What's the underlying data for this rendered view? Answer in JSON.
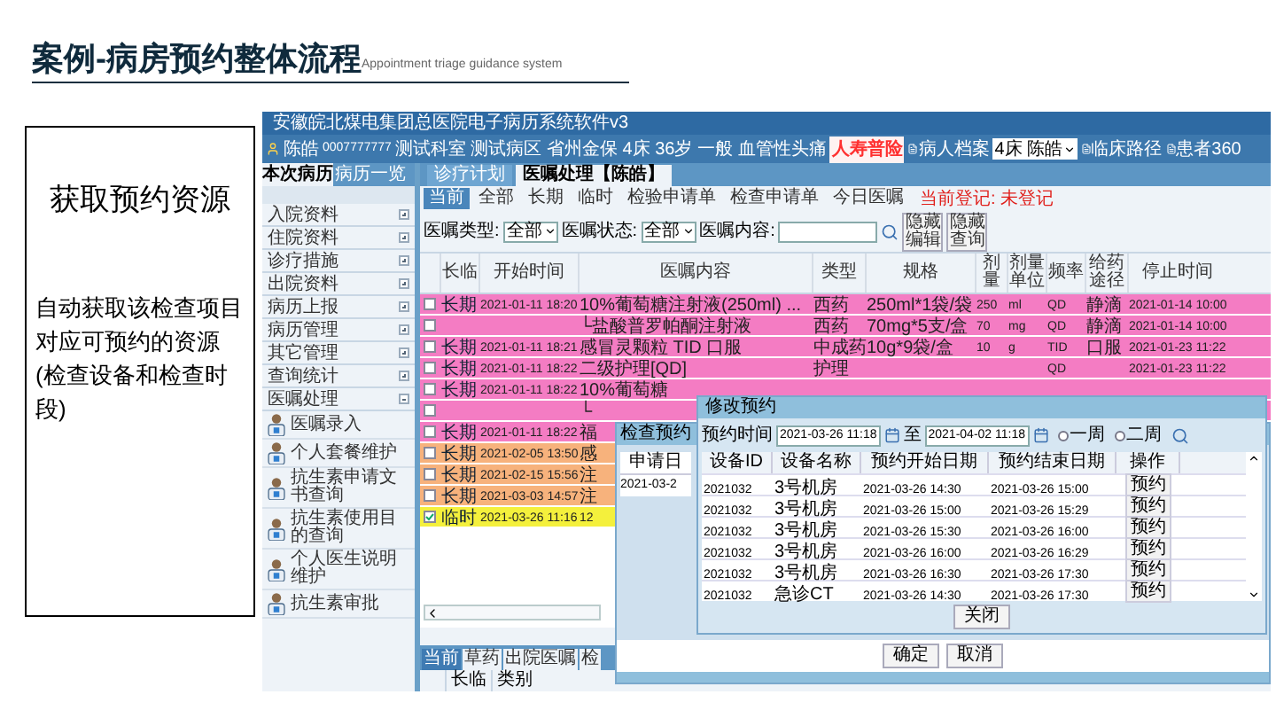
{
  "slide": {
    "title": "案例-病房预约整体流程",
    "subtitle": "Appointment triage guidance system"
  },
  "note": {
    "heading": "获取预约资源",
    "body": "自动获取该检查项目对应可预约的资源(检查设备和检查时段)"
  },
  "app": {
    "title": "安徽皖北煤电集团总医院电子病历系统软件v3",
    "patient": {
      "name": "陈皓",
      "id": "0007777777",
      "info": "测试科室 测试病区 省州金保 4床 36岁 一般 血管性头痛",
      "insurance": "人寿普险"
    },
    "toolbar": [
      {
        "kind": "link",
        "label": "病人档案"
      },
      {
        "kind": "select",
        "value": "4床 陈皓"
      },
      {
        "kind": "link",
        "label": "临床路径"
      },
      {
        "kind": "link",
        "label": "患者360"
      }
    ],
    "sidebar": {
      "tabs": [
        {
          "label": "本次病历",
          "selected": true
        },
        {
          "label": "病历一览",
          "selected": false
        }
      ],
      "items": [
        {
          "label": "入院资料",
          "expanded": false
        },
        {
          "label": "住院资料",
          "expanded": false
        },
        {
          "label": "诊疗措施",
          "expanded": false
        },
        {
          "label": "出院资料",
          "expanded": false
        },
        {
          "label": "病历上报",
          "expanded": false
        },
        {
          "label": "病历管理",
          "expanded": false
        },
        {
          "label": "其它管理",
          "expanded": false
        },
        {
          "label": "查询统计",
          "expanded": false
        },
        {
          "label": "医嘱处理",
          "expanded": true,
          "children": [
            {
              "label": "医嘱录入"
            },
            {
              "label": "个人套餐维护"
            },
            {
              "label": "抗生素申请文书查询"
            },
            {
              "label": "抗生素使用目的查询"
            },
            {
              "label": "个人医生说明维护"
            },
            {
              "label": "抗生素审批"
            }
          ]
        }
      ]
    },
    "main": {
      "tabs": [
        {
          "label": "诊疗计划",
          "selected": false
        },
        {
          "label": "医嘱处理【陈皓】",
          "selected": true
        }
      ],
      "filter_tabs": [
        {
          "label": "当前",
          "selected": true
        },
        {
          "label": "全部",
          "selected": false
        },
        {
          "label": "长期",
          "selected": false
        },
        {
          "label": "临时",
          "selected": false
        },
        {
          "label": "检验申请单",
          "selected": false
        },
        {
          "label": "检查申请单",
          "selected": false
        },
        {
          "label": "今日医嘱",
          "selected": false
        }
      ],
      "registration": "当前登记: 未登记",
      "filters": [
        {
          "label": "医嘱类型:",
          "value": "全部"
        },
        {
          "label": "医嘱状态:",
          "value": "全部"
        }
      ],
      "content_filter": {
        "label": "医嘱内容:"
      },
      "buttons": [
        "隐藏编辑",
        "隐藏查询"
      ],
      "table": {
        "columns": [
          "长临",
          "开始时间",
          "医嘱内容",
          "类型",
          "规格",
          "剂量",
          "剂量单位",
          "频率",
          "给药途径",
          "停止时间"
        ],
        "rows": [
          {
            "checked": false,
            "color": "#f47cc3",
            "cells": [
              "长期",
              "2021-01-11 18:20",
              "10%葡萄糖注射液(250ml) ...",
              "西药",
              "250ml*1袋/袋",
              "250",
              "ml",
              "QD",
              "静滴",
              "2021-01-14 10:00"
            ]
          },
          {
            "checked": false,
            "color": "#f47cc3",
            "cells": [
              "",
              "",
              "└盐酸普罗帕酮注射液",
              "西药",
              "70mg*5支/盒",
              "70",
              "mg",
              "QD",
              "静滴",
              "2021-01-14 10:00"
            ]
          },
          {
            "checked": false,
            "color": "#f47cc3",
            "cells": [
              "长期",
              "2021-01-11 18:21",
              "感冒灵颗粒 TID 口服",
              "中成药",
              "10g*9袋/盒",
              "10",
              "g",
              "TID",
              "口服",
              "2021-01-23 11:22"
            ]
          },
          {
            "checked": false,
            "color": "#f47cc3",
            "cells": [
              "长期",
              "2021-01-11 18:22",
              "二级护理[QD]",
              "护理",
              "",
              "",
              "",
              "QD",
              "",
              "2021-01-23 11:22"
            ]
          },
          {
            "checked": false,
            "color": "#f47cc3",
            "cells": [
              "长期",
              "2021-01-11 18:22",
              "10%葡萄糖"
            ]
          },
          {
            "checked": false,
            "color": "#f47cc3",
            "cells": [
              "",
              "",
              "└"
            ]
          },
          {
            "checked": false,
            "color": "#f47cc3",
            "cells": [
              "长期",
              "2021-01-11 18:22",
              "福"
            ]
          },
          {
            "checked": false,
            "color": "#f7b27c",
            "cells": [
              "长期",
              "2021-02-05 13:50",
              "感"
            ]
          },
          {
            "checked": false,
            "color": "#f7b27c",
            "cells": [
              "长期",
              "2021-02-15 15:56",
              "注"
            ]
          },
          {
            "checked": false,
            "color": "#f7b27c",
            "cells": [
              "长期",
              "2021-03-03 14:57",
              "注"
            ]
          },
          {
            "checked": true,
            "color": "#f4f03c",
            "cells": [
              "临时",
              "2021-03-26 11:16",
              "12"
            ]
          }
        ]
      },
      "bottom_tabs": [
        {
          "label": "当前",
          "selected": true
        },
        {
          "label": "草药",
          "selected": false
        },
        {
          "label": "出院医嘱",
          "selected": false
        },
        {
          "label": "检",
          "selected": false
        }
      ],
      "bottom_columns": [
        "长临",
        "类别"
      ]
    },
    "exam_dialog": {
      "title": "检查预约",
      "columns": [
        "申请日"
      ],
      "rows": [
        [
          "2021-03-2"
        ]
      ],
      "buttons": [
        "确定",
        "取消"
      ]
    },
    "modify_dialog": {
      "title": "修改预约",
      "time_label": "预约时间",
      "from": "2021-03-26 11:18",
      "to_label": "至",
      "to": "2021-04-02 11:18",
      "ranges": [
        {
          "label": "一周",
          "selected": false
        },
        {
          "label": "二周",
          "selected": false
        }
      ],
      "columns": [
        "设备ID",
        "设备名称",
        "预约开始日期",
        "预约结束日期",
        "操作"
      ],
      "rows": [
        {
          "id": "2021032",
          "name": "3号机房",
          "start": "2021-03-26 14:30",
          "end": "2021-03-26 15:00",
          "action": "预约"
        },
        {
          "id": "2021032",
          "name": "3号机房",
          "start": "2021-03-26 15:00",
          "end": "2021-03-26 15:29",
          "action": "预约"
        },
        {
          "id": "2021032",
          "name": "3号机房",
          "start": "2021-03-26 15:30",
          "end": "2021-03-26 16:00",
          "action": "预约"
        },
        {
          "id": "2021032",
          "name": "3号机房",
          "start": "2021-03-26 16:00",
          "end": "2021-03-26 16:29",
          "action": "预约"
        },
        {
          "id": "2021032",
          "name": "3号机房",
          "start": "2021-03-26 16:30",
          "end": "2021-03-26 17:30",
          "action": "预约"
        },
        {
          "id": "2021032",
          "name": "急诊CT",
          "start": "2021-03-26 14:30",
          "end": "2021-03-26 17:30",
          "action": "预约"
        }
      ],
      "close": "关闭"
    }
  }
}
